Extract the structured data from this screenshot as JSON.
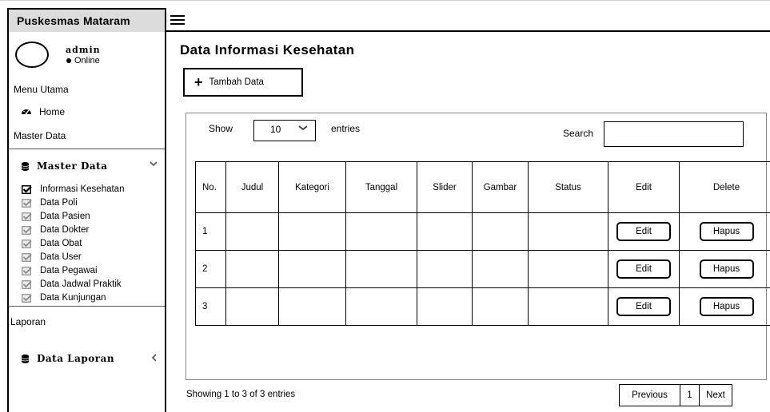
{
  "app": {
    "brand": "Puskesmas Mataram"
  },
  "user": {
    "name": "admin",
    "status": "Online"
  },
  "sidebar": {
    "menu_utama": "Menu Utama",
    "home": "Home",
    "master_data_label": "Master Data",
    "master_section_title": "Master Data",
    "items": [
      {
        "label": "Informasi Kesehatan",
        "active": true
      },
      {
        "label": "Data Poli",
        "active": false
      },
      {
        "label": "Data Pasien",
        "active": false
      },
      {
        "label": "Data Dokter",
        "active": false
      },
      {
        "label": "Data Obat",
        "active": false
      },
      {
        "label": "Data User",
        "active": false
      },
      {
        "label": "Data Pegawai",
        "active": false
      },
      {
        "label": "Data Jadwal Praktik",
        "active": false
      },
      {
        "label": "Data Kunjungan",
        "active": false
      }
    ],
    "laporan_label": "Laporan",
    "laporan_section_title": "Data Laporan"
  },
  "main": {
    "title": "Data Informasi Kesehatan",
    "add_button": "Tambah Data",
    "show_label": "Show",
    "show_value": "10",
    "entries_label": "entries",
    "search_label": "Search",
    "search_value": "",
    "columns": [
      "No.",
      "Judul",
      "Kategori",
      "Tanggal",
      "Slider",
      "Gambar",
      "Status",
      "Edit",
      "Delete"
    ],
    "rows": [
      {
        "no": "1",
        "edit": "Edit",
        "delete": "Hapus"
      },
      {
        "no": "2",
        "edit": "Edit",
        "delete": "Hapus"
      },
      {
        "no": "3",
        "edit": "Edit",
        "delete": "Hapus"
      }
    ],
    "footer_info": "Showing 1 to 3 of 3 entries",
    "pagination": {
      "prev": "Previous",
      "page": "1",
      "next": "Next"
    }
  }
}
